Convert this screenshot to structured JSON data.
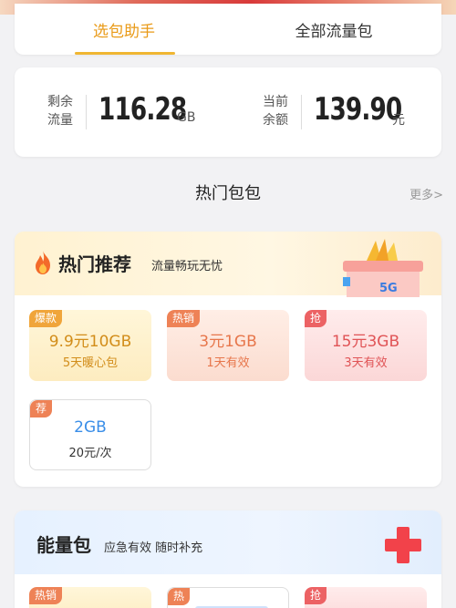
{
  "tabs": [
    {
      "label": "选包助手",
      "active": true
    },
    {
      "label": "全部流量包",
      "active": false
    }
  ],
  "balance": {
    "remaining_label": "剩余\n流量",
    "remaining_value": "116.28",
    "remaining_unit": "GB",
    "current_label": "当前\n余额",
    "current_value": "139.90",
    "current_unit": "元"
  },
  "section": {
    "title": "热门包包",
    "more": "更多>"
  },
  "hot": {
    "title": "热门推荐",
    "subtitle": "流量畅玩无忧",
    "gift_text": "5G",
    "packages": [
      {
        "badge": "爆款",
        "price": "9.9元10GB",
        "desc": "5天暖心包"
      },
      {
        "badge": "热销",
        "price": "3元1GB",
        "desc": "1天有效"
      },
      {
        "badge": "抢",
        "price": "15元3GB",
        "desc": "3天有效"
      },
      {
        "badge": "荐",
        "price": "2GB",
        "desc": "20元/次"
      }
    ]
  },
  "energy": {
    "title": "能量包",
    "subtitle": "应急有效 随时补充",
    "packages": [
      {
        "badge": "热销"
      },
      {
        "badge": "热"
      },
      {
        "badge": "抢"
      }
    ]
  },
  "colors": {
    "accent": "#f0b632",
    "active_tab": "#e99a17",
    "link_blue": "#3a8ee8"
  }
}
